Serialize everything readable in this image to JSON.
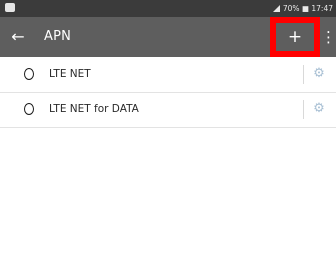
{
  "status_bar": {
    "text": "70% ■ 17:47"
  },
  "app_bar": {
    "back_icon": "arrow-left-icon",
    "title": "APN",
    "add_label": "+",
    "more_icon": "more-vert-icon"
  },
  "apn_list": [
    {
      "label": "LTE NET",
      "selected": false,
      "settings_icon": "gear-icon"
    },
    {
      "label": "LTE NET for DATA",
      "selected": false,
      "settings_icon": "gear-icon"
    }
  ],
  "colors": {
    "app_bar": "#5e5e5e",
    "status_bar": "#3b3b3b",
    "highlight": "#ff0000",
    "gear": "#a9c0d4"
  }
}
